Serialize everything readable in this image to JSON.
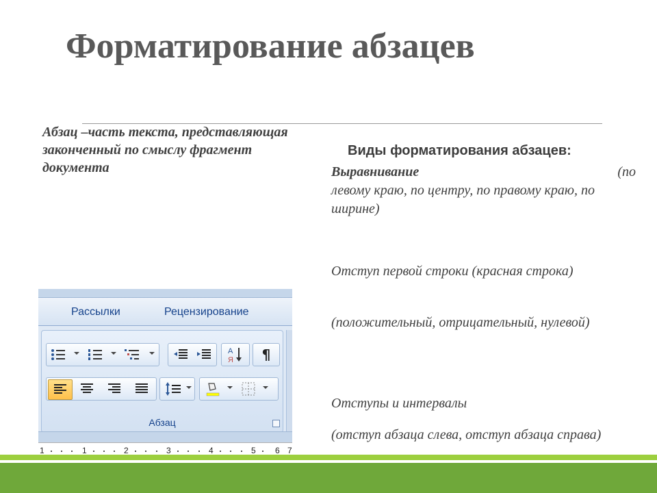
{
  "slide": {
    "title": "Форматирование абзацев",
    "definition": "Абзац –часть текста, представляющая законченный по смыслу фрагмент документа",
    "right_heading": "Виды форматирования абзацев:",
    "items": {
      "align_term": "Выравнивание",
      "align_paren": "(по",
      "align_rest": "левому краю, по центру, по правому краю, по ширине)",
      "indent_term": "Отступ первой строки (красная строка)",
      "indent_desc": "(положительный, отрицательный, нулевой)",
      "spacing_term": "Отступы и интервалы",
      "spacing_desc": "(отступ абзаца слева, отступ абзаца справа)"
    }
  },
  "ribbon": {
    "tabs": [
      "Рассылки",
      "Рецензирование"
    ],
    "group_label": "Абзац",
    "ruler_numbers": [
      "1",
      "1",
      "2",
      "3",
      "4",
      "5",
      "6",
      "7"
    ],
    "icons": [
      "bullets-icon",
      "numbering-icon",
      "multilevel-list-icon",
      "decrease-indent-icon",
      "increase-indent-icon",
      "sort-icon",
      "pilcrow-icon",
      "align-left-icon",
      "align-center-icon",
      "align-right-icon",
      "justify-icon",
      "line-spacing-icon",
      "shading-icon",
      "borders-icon"
    ]
  },
  "colors": {
    "title": "#595959",
    "text": "#404040",
    "ribbon_accent": "#15428b",
    "green_light": "#9ccf3e",
    "green_dark": "#6fa83a"
  }
}
